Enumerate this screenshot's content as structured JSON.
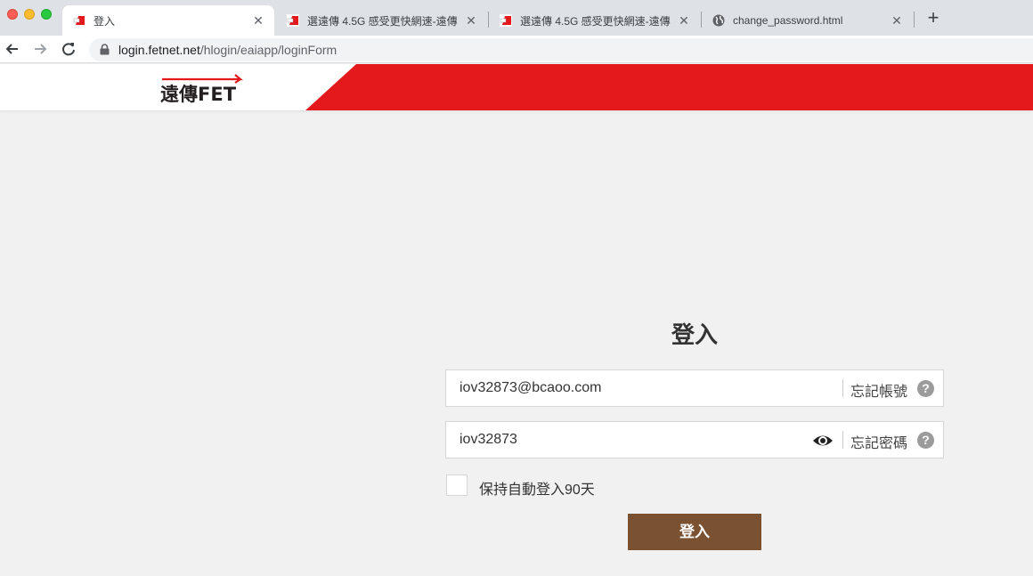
{
  "browser": {
    "tabs": [
      {
        "title": "登入",
        "active": true
      },
      {
        "title": "選遠傳 4.5G 感受更快網速-遠傳",
        "active": false
      },
      {
        "title": "選遠傳 4.5G 感受更快網速-遠傳",
        "active": false
      },
      {
        "title": "change_password.html",
        "active": false
      }
    ],
    "url_host": "login.fetnet.net",
    "url_path": "/hlogin/eaiapp/loginForm"
  },
  "header": {
    "logo_text": "遠傳FET",
    "brand_color": "#e3191b"
  },
  "login": {
    "title": "登入",
    "username_value": "iov32873@bcaoo.com",
    "forgot_account": "忘記帳號",
    "password_value": "iov32873",
    "forgot_password": "忘記密碼",
    "help_glyph": "?",
    "remember_label": "保持自動登入90天",
    "submit_label": "登入",
    "submit_color": "#7a5231"
  },
  "icons": {
    "help": "question-circle-icon",
    "show_password": "eye-icon",
    "lock": "lock-icon"
  }
}
